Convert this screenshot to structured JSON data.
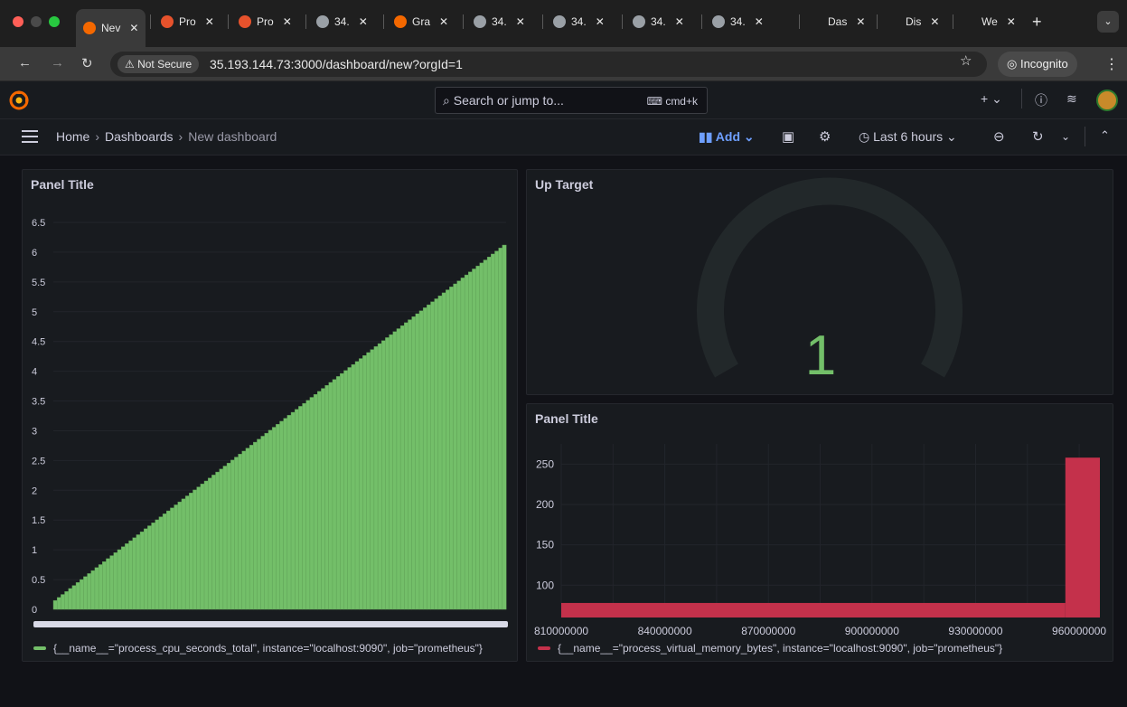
{
  "browser": {
    "tabs": [
      {
        "label": "Nev",
        "icon": "grafana-icon",
        "active": true
      },
      {
        "label": "Pro",
        "icon": "prometheus-icon"
      },
      {
        "label": "Pro",
        "icon": "prometheus-icon"
      },
      {
        "label": "34.",
        "icon": "globe-icon"
      },
      {
        "label": "Gra",
        "icon": "grafana-icon"
      },
      {
        "label": "34.",
        "icon": "globe-icon"
      },
      {
        "label": "34.",
        "icon": "globe-icon"
      },
      {
        "label": "34.",
        "icon": "globe-icon"
      },
      {
        "label": "34.",
        "icon": "globe-icon"
      },
      {
        "label": "Das",
        "icon": "blank-icon"
      },
      {
        "label": "Dis",
        "icon": "blank-icon"
      },
      {
        "label": "We",
        "icon": "blank-icon"
      }
    ],
    "not_secure": "Not Secure",
    "url": "35.193.144.73:3000/dashboard/new?orgId=1",
    "incognito": "Incognito"
  },
  "grafana": {
    "search_placeholder": "Search or jump to...",
    "search_shortcut": "cmd+k",
    "breadcrumbs": [
      "Home",
      "Dashboards",
      "New dashboard"
    ],
    "add_label": "Add",
    "time_range": "Last 6 hours"
  },
  "panels": {
    "cpu": {
      "title": "Panel Title",
      "legend": "{__name__=\"process_cpu_seconds_total\", instance=\"localhost:9090\", job=\"prometheus\"}",
      "color": "#73bf69"
    },
    "up": {
      "title": "Up Target",
      "value": "1",
      "color": "#73bf69"
    },
    "mem": {
      "title": "Panel Title",
      "legend": "{__name__=\"process_virtual_memory_bytes\", instance=\"localhost:9090\", job=\"prometheus\"}",
      "color": "#c4314b"
    }
  },
  "chart_data": [
    {
      "type": "bar",
      "title": "Panel Title",
      "y_ticks": [
        "0",
        "0.5",
        "1",
        "1.5",
        "2",
        "2.5",
        "3",
        "3.5",
        "4",
        "4.5",
        "5",
        "5.5",
        "6",
        "6.5"
      ],
      "ylim": [
        0,
        6.5
      ],
      "series": [
        {
          "name": "{__name__=\"process_cpu_seconds_total\", instance=\"localhost:9090\", job=\"prometheus\"}",
          "start": 0.15,
          "end": 6.12,
          "bar_count": 120
        }
      ],
      "grid": true
    },
    {
      "type": "gauge",
      "title": "Up Target",
      "value": 1
    },
    {
      "type": "bar",
      "title": "Panel Title",
      "x_ticks": [
        "810000000",
        "840000000",
        "870000000",
        "900000000",
        "930000000",
        "960000000"
      ],
      "y_ticks": [
        "100",
        "150",
        "200",
        "250"
      ],
      "bars": [
        {
          "x_start": 810000000,
          "x_end": 956000000,
          "value": 78
        },
        {
          "x_start": 956000000,
          "x_end": 966000000,
          "value": 258
        }
      ],
      "series": [
        {
          "name": "{__name__=\"process_virtual_memory_bytes\", instance=\"localhost:9090\", job=\"prometheus\"}"
        }
      ],
      "grid": true
    }
  ]
}
